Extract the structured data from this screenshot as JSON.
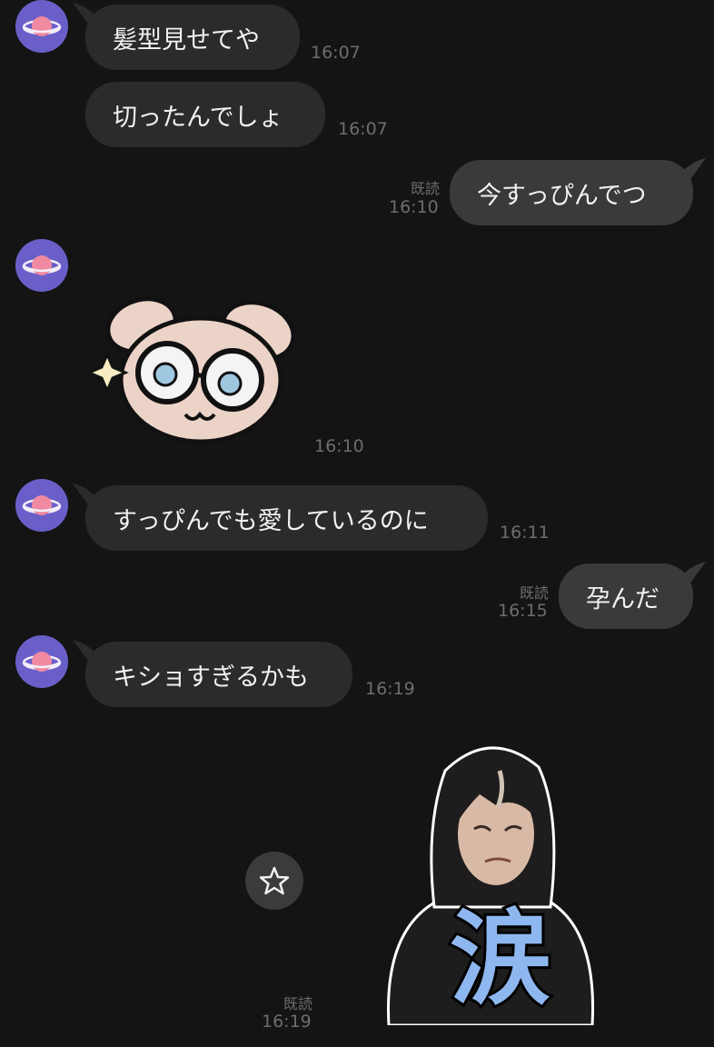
{
  "messages": {
    "m1": {
      "text": "髪型見せてや",
      "time": "16:07"
    },
    "m2": {
      "text": "切ったんでしょ",
      "time": "16:07"
    },
    "m3": {
      "text": "今すっぴんでつ",
      "read": "既読",
      "time": "16:10"
    },
    "m4": {
      "time": "16:10",
      "sticker": "dog-with-glasses-sticker"
    },
    "m5": {
      "text": "すっぴんでも愛しているのに",
      "time": "16:11"
    },
    "m6": {
      "text": "孕んだ",
      "read": "既読",
      "time": "16:15"
    },
    "m7": {
      "text": "キショすぎるかも",
      "time": "16:19"
    },
    "m8": {
      "read": "既読",
      "time": "16:19",
      "sticker_text": "涙"
    }
  },
  "colors": {
    "background": "#141414",
    "incoming_bubble": "#2b2b2d",
    "outgoing_bubble": "#3a3a3c",
    "avatar": "#6a5fc9",
    "planet": "#f08aa0",
    "timestamp": "#6d6d6d"
  },
  "icons": {
    "avatar": "planet-icon",
    "favorite": "star-outline-icon"
  }
}
